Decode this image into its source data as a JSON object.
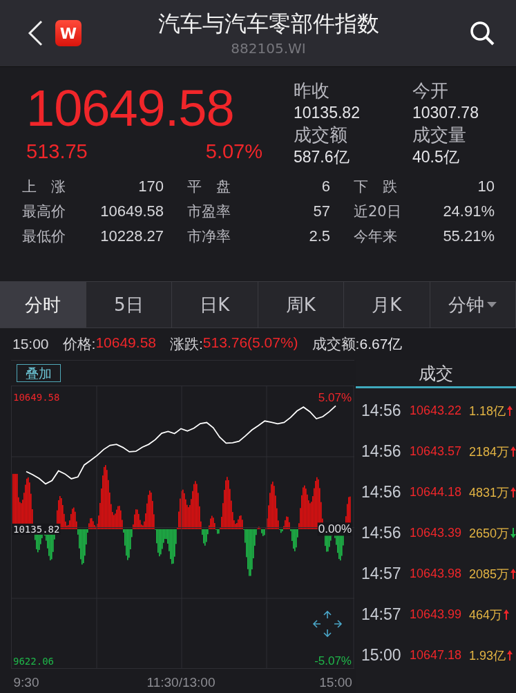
{
  "header": {
    "title": "汽车与汽车零部件指数",
    "code": "882105.WI",
    "logo": "W"
  },
  "quote": {
    "price": "10649.58",
    "change": "513.75",
    "change_pct": "5.07%",
    "fields": [
      {
        "label": "昨收",
        "value": "10135.82"
      },
      {
        "label": "今开",
        "value": "10307.78"
      },
      {
        "label": "成交额",
        "value": "587.6亿"
      },
      {
        "label": "成交量",
        "value": "40.5亿"
      }
    ]
  },
  "stats": [
    [
      {
        "label": "上　涨",
        "value": "170"
      },
      {
        "label": "平　盘",
        "value": "6"
      },
      {
        "label": "下　跌",
        "value": "10"
      }
    ],
    [
      {
        "label": "最高价",
        "value": "10649.58"
      },
      {
        "label": "市盈率",
        "value": "57"
      },
      {
        "label": "近20日",
        "value": "24.91%"
      }
    ],
    [
      {
        "label": "最低价",
        "value": "10228.27"
      },
      {
        "label": "市净率",
        "value": "2.5"
      },
      {
        "label": "今年来",
        "value": "55.21%"
      }
    ]
  ],
  "tabs": [
    {
      "label": "分时",
      "selected": true,
      "dropdown": false
    },
    {
      "label": "5日",
      "selected": false,
      "dropdown": false
    },
    {
      "label": "日K",
      "selected": false,
      "dropdown": false
    },
    {
      "label": "周K",
      "selected": false,
      "dropdown": false
    },
    {
      "label": "月K",
      "selected": false,
      "dropdown": false
    },
    {
      "label": "分钟",
      "selected": false,
      "dropdown": true
    }
  ],
  "info_line": {
    "time": "15:00",
    "items": [
      {
        "label": "价格:",
        "value": "10649.58",
        "kind": "red"
      },
      {
        "label": "涨跌:",
        "value": "513.76(5.07%)",
        "kind": "red"
      },
      {
        "label": "成交额:",
        "value": "6.67亿",
        "kind": "plain"
      }
    ]
  },
  "overlay_button": "叠加",
  "right_axis_labels": [
    {
      "label": "5.07%",
      "kind": "up"
    },
    {
      "label": "0.00%",
      "kind": "flat"
    },
    {
      "label": "-5.07%",
      "kind": "down"
    }
  ],
  "chart_data": {
    "type": "line",
    "categories": [
      "9:30",
      null,
      null,
      null,
      null,
      null,
      null,
      null,
      null,
      null,
      null,
      null,
      null,
      null,
      null,
      null,
      null,
      null,
      null,
      null,
      null,
      null,
      null,
      null,
      "11:30/13:00",
      null,
      null,
      null,
      null,
      null,
      null,
      null,
      null,
      null,
      null,
      null,
      null,
      null,
      null,
      null,
      null,
      null,
      null,
      null,
      null,
      null,
      null,
      null,
      "15:00"
    ],
    "series": [
      {
        "color": "#ffffff",
        "values": [
          10360,
          10348,
          10333,
          10312,
          10325,
          10363,
          10351,
          10332,
          10339,
          10386,
          10404,
          10423,
          10446,
          10462,
          10466,
          10454,
          10437,
          10439,
          10455,
          10466,
          10484,
          10509,
          10516,
          10508,
          10527,
          10518,
          10529,
          10547,
          10551,
          10531,
          10494,
          10471,
          10472,
          10478,
          10499,
          10522,
          10539,
          10557,
          10552,
          10546,
          10551,
          10571,
          10596,
          10611,
          10593,
          10566,
          10574,
          10593,
          10616
        ]
      }
    ],
    "ylim": [
      9592,
      10695
    ],
    "yticks": [
      {
        "value": 9622.06,
        "label": "9622.06"
      },
      {
        "value": 10135.82,
        "label": "10135.82"
      },
      {
        "value": 10649.58,
        "label": "10649.58"
      }
    ]
  },
  "trades_title": "成交",
  "trades": [
    {
      "time": "14:56",
      "price": "10643.22",
      "amount": "1.18亿",
      "rising": true
    },
    {
      "time": "14:56",
      "price": "10643.57",
      "amount": "2184万",
      "rising": true
    },
    {
      "time": "14:56",
      "price": "10644.18",
      "amount": "4831万",
      "rising": true
    },
    {
      "time": "14:56",
      "price": "10643.39",
      "amount": "2650万",
      "rising": false
    },
    {
      "time": "14:57",
      "price": "10643.98",
      "amount": "2085万",
      "rising": true
    },
    {
      "time": "14:57",
      "price": "10643.99",
      "amount": "464万",
      "rising": true
    },
    {
      "time": "15:00",
      "price": "10647.18",
      "amount": "1.93亿",
      "rising": true
    }
  ]
}
